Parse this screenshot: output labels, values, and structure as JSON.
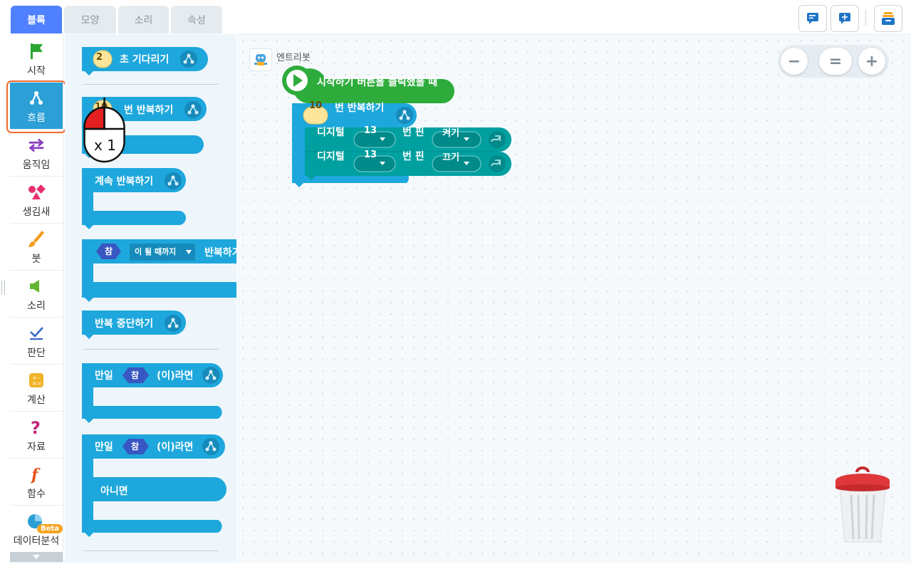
{
  "tabs": [
    {
      "label": "블록",
      "active": true
    },
    {
      "label": "모양",
      "active": false
    },
    {
      "label": "소리",
      "active": false
    },
    {
      "label": "속성",
      "active": false
    }
  ],
  "categories": [
    {
      "label": "시작",
      "icon": "flag-icon"
    },
    {
      "label": "흐름",
      "icon": "flow-icon",
      "active": true
    },
    {
      "label": "움직임",
      "icon": "move-arrows-icon"
    },
    {
      "label": "생김새",
      "icon": "looks-shapes-icon"
    },
    {
      "label": "붓",
      "icon": "brush-icon"
    },
    {
      "label": "소리",
      "icon": "speaker-icon"
    },
    {
      "label": "판단",
      "icon": "checkmark-icon"
    },
    {
      "label": "계산",
      "icon": "calculator-icon"
    },
    {
      "label": "자료",
      "icon": "question-icon"
    },
    {
      "label": "함수",
      "icon": "function-icon"
    },
    {
      "label": "데이터분석",
      "icon": "pie-chart-icon",
      "badge": "Beta"
    }
  ],
  "palette": {
    "wait": {
      "value": "2",
      "label": "초 기다리기"
    },
    "repeat_n": {
      "value": "10",
      "label": "번 반복하기"
    },
    "repeat_forever": {
      "label": "계속 반복하기"
    },
    "repeat_until": {
      "cond": "참",
      "dropdown": "이 될 때까지",
      "label": "반복하기"
    },
    "break": {
      "label": "반복 중단하기"
    },
    "if": {
      "prefix": "만일",
      "cond": "참",
      "suffix": "(이)라면"
    },
    "if_else": {
      "prefix": "만일",
      "cond": "참",
      "suffix": "(이)라면",
      "else_label": "아니면"
    }
  },
  "cursor_overlay": {
    "label": "x 1"
  },
  "workspace": {
    "object_name": "엔트리봇",
    "start_block": "시작하기 버튼을 클릭했을 때",
    "repeat": {
      "value": "10",
      "label": "번 반복하기"
    },
    "digital_blocks": [
      {
        "prefix": "디지털",
        "pin": "13",
        "mid": "번 핀",
        "state": "켜기"
      },
      {
        "prefix": "디지털",
        "pin": "13",
        "mid": "번 핀",
        "state": "끄기"
      }
    ]
  },
  "zoom": {
    "minus": "−",
    "reset": "=",
    "plus": "+"
  },
  "colors": {
    "tab_active": "#4f80ff",
    "flow_block": "#1ea7dc",
    "start_block": "#2dac3b",
    "hardware_block": "#00a0a0",
    "category_active": "#2b9fd6"
  }
}
